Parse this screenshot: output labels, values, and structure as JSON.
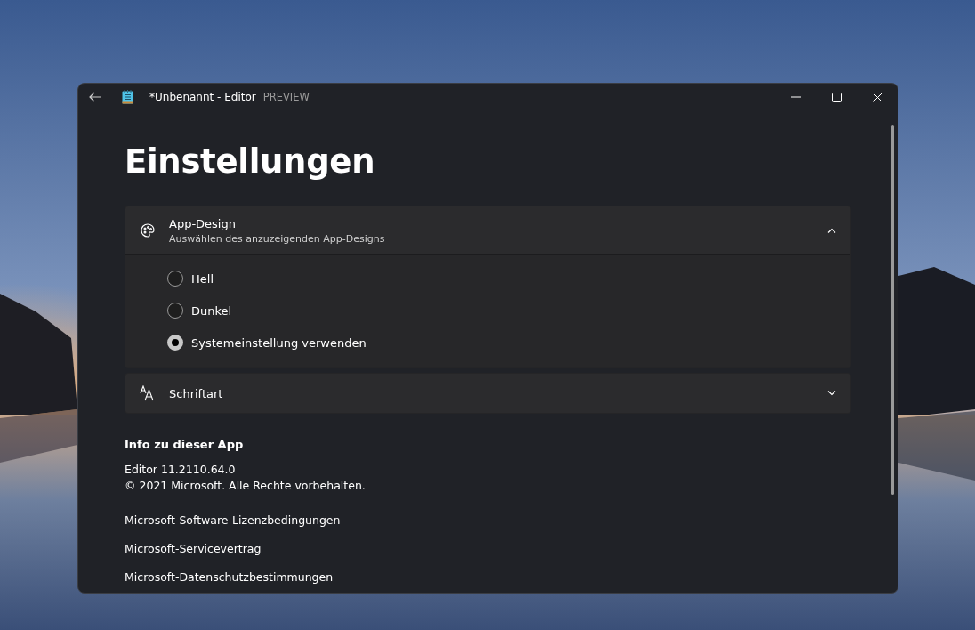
{
  "window": {
    "title": "*Unbenannt - Editor",
    "badge": "PREVIEW"
  },
  "page_title": "Einstellungen",
  "sections": [
    {
      "kind": "palette",
      "title": "App-Design",
      "subtitle": "Auswählen des anzuzeigenden App-Designs",
      "expanded": true,
      "options": [
        {
          "label": "Hell",
          "selected": false
        },
        {
          "label": "Dunkel",
          "selected": false
        },
        {
          "label": "Systemeinstellung verwenden",
          "selected": true
        }
      ]
    },
    {
      "kind": "font",
      "title": "Schriftart",
      "expanded": false
    }
  ],
  "about": {
    "title": "Info zu dieser App",
    "version": "Editor 11.2110.64.0",
    "copyright": "© 2021 Microsoft. Alle Rechte vorbehalten.",
    "links": [
      "Microsoft-Software-Lizenzbedingungen",
      "Microsoft-Servicevertrag",
      "Microsoft-Datenschutzbestimmungen"
    ]
  }
}
